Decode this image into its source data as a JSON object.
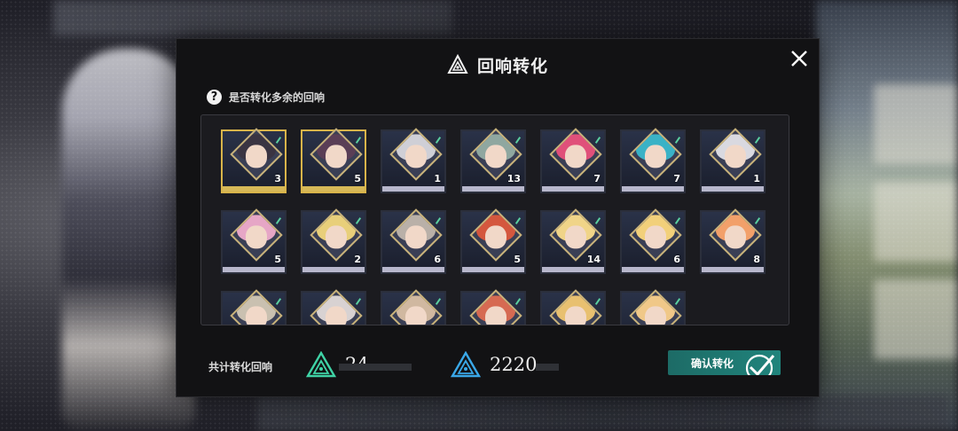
{
  "dialog": {
    "title": "回响转化",
    "title_icon": "echo-triangle-icon",
    "help_text": "是否转化多余的回响",
    "close_icon": "close-icon"
  },
  "echo_cards": [
    {
      "count": "3",
      "selected": true,
      "hair": "#3a3442"
    },
    {
      "count": "5",
      "selected": true,
      "hair": "#5a3e56"
    },
    {
      "count": "1",
      "selected": false,
      "hair": "#cfcfd6"
    },
    {
      "count": "13",
      "selected": false,
      "hair": "#8fa7a0"
    },
    {
      "count": "7",
      "selected": false,
      "hair": "#e0507a"
    },
    {
      "count": "7",
      "selected": false,
      "hair": "#3ab2c6"
    },
    {
      "count": "1",
      "selected": false,
      "hair": "#d9d9e0"
    },
    {
      "count": "5",
      "selected": false,
      "hair": "#e6a6c6"
    },
    {
      "count": "2",
      "selected": false,
      "hair": "#e8cf7a"
    },
    {
      "count": "6",
      "selected": false,
      "hair": "#b9b0a8"
    },
    {
      "count": "5",
      "selected": false,
      "hair": "#d4573e"
    },
    {
      "count": "14",
      "selected": false,
      "hair": "#f0d488"
    },
    {
      "count": "6",
      "selected": false,
      "hair": "#f2d07a"
    },
    {
      "count": "8",
      "selected": false,
      "hair": "#f2a06a"
    },
    {
      "count": "",
      "selected": false,
      "hair": "#c9c0b0"
    },
    {
      "count": "",
      "selected": false,
      "hair": "#d8d2d2"
    },
    {
      "count": "",
      "selected": false,
      "hair": "#d0b8a0"
    },
    {
      "count": "",
      "selected": false,
      "hair": "#d66a52"
    },
    {
      "count": "",
      "selected": false,
      "hair": "#e8c070"
    },
    {
      "count": "",
      "selected": false,
      "hair": "#f0c888"
    }
  ],
  "footer": {
    "total_label": "共计转化回响",
    "green_value": "24",
    "blue_value": "2220",
    "confirm_label": "确认转化"
  },
  "colors": {
    "accent_teal": "#1d7a74",
    "selected_gold": "#d8b44a",
    "green_icon": "#3fd3a6",
    "blue_icon": "#3aa8e8"
  }
}
